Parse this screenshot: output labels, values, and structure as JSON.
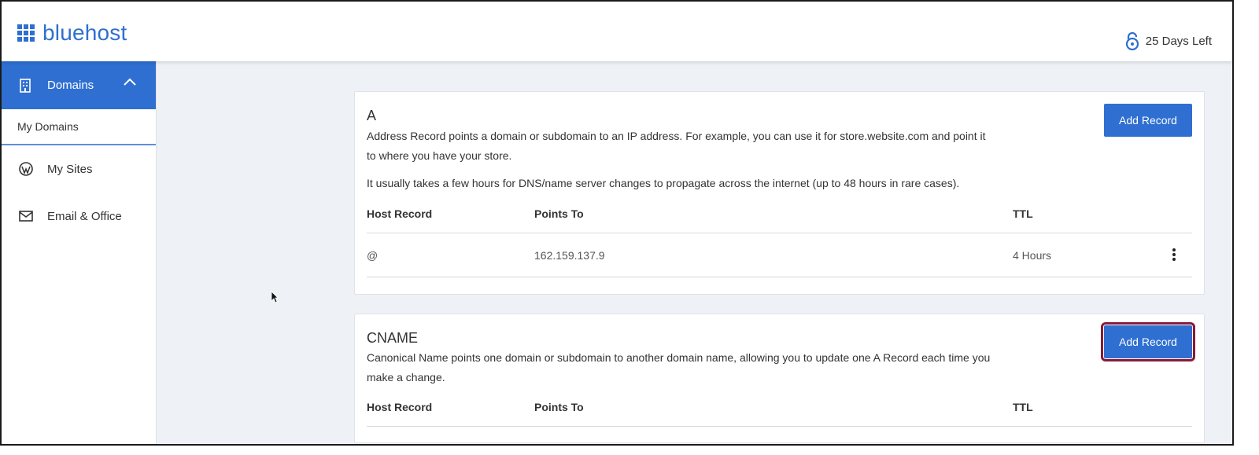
{
  "header": {
    "logo_text": "bluehost",
    "trial_text": "25 Days Left"
  },
  "sidebar": {
    "active_section": "Domains",
    "sub_item": "My Domains",
    "items": [
      {
        "label": "My Sites",
        "icon": "wordpress-icon"
      },
      {
        "label": "Email & Office",
        "icon": "envelope-icon"
      }
    ]
  },
  "records": {
    "a": {
      "title": "A",
      "description": "Address Record points a domain or subdomain to an IP address. For example, you can use it for store.website.com and point it to where you have your store.",
      "note": "It usually takes a few hours for DNS/name server changes to propagate across the internet (up to 48 hours in rare cases).",
      "button": "Add Record",
      "columns": [
        "Host Record",
        "Points To",
        "TTL"
      ],
      "rows": [
        {
          "host": "@",
          "points_to": "162.159.137.9",
          "ttl": "4 Hours"
        }
      ]
    },
    "cname": {
      "title": "CNAME",
      "description": "Canonical Name points one domain or subdomain to another domain name, allowing you to update one A Record each time you make a change.",
      "button": "Add Record",
      "columns": [
        "Host Record",
        "Points To",
        "TTL"
      ]
    }
  },
  "colors": {
    "brand_blue": "#2f6fd1",
    "highlight_outline": "#8a1a3a"
  }
}
